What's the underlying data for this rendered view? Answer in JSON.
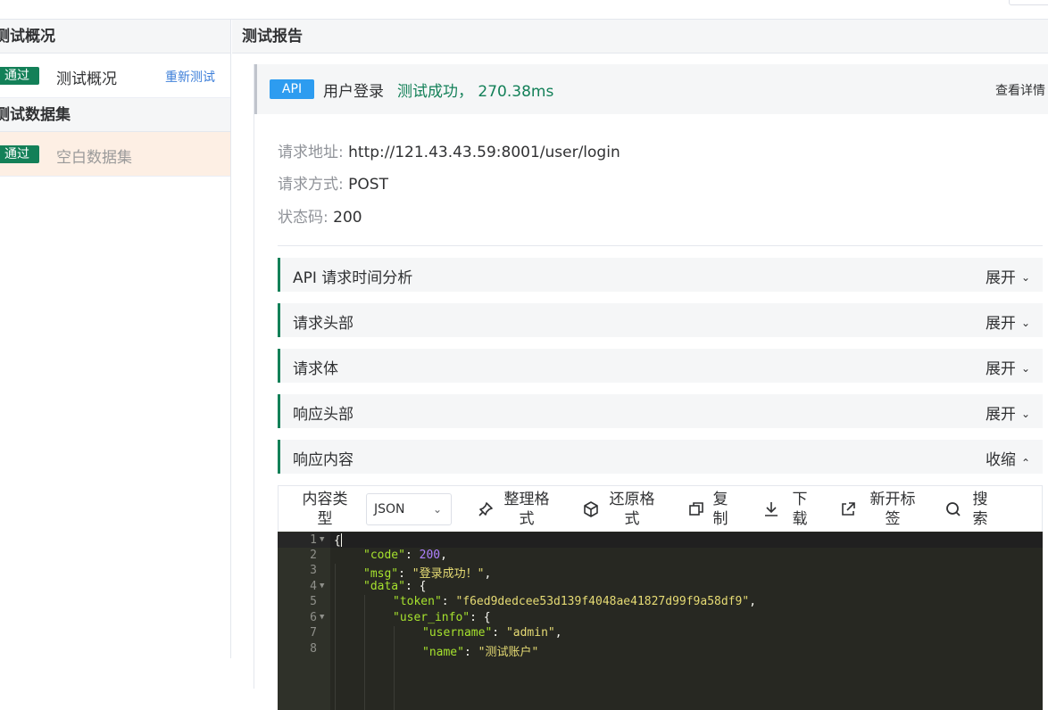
{
  "sidebar": {
    "overview_header": "测试概况",
    "overview_row": {
      "tag": "通过",
      "label": "测试概况",
      "link": "重新测试"
    },
    "dataset_header": "测试数据集",
    "dataset_row": {
      "tag": "通过",
      "label": "空白数据集"
    }
  },
  "main": {
    "header": "测试报告",
    "api": {
      "tag": "API",
      "name": "用户登录",
      "result": "测试成功， 270.38ms",
      "detail_link": "查看详情"
    },
    "info": {
      "url_key": "请求地址:",
      "url_value": "http://121.43.43.59:8001/user/login",
      "method_key": "请求方式:",
      "method_value": "POST",
      "status_key": "状态码:",
      "status_value": "200"
    },
    "sections": [
      {
        "title": "API 请求时间分析",
        "toggle": "展开"
      },
      {
        "title": "请求头部",
        "toggle": "展开"
      },
      {
        "title": "请求体",
        "toggle": "展开"
      },
      {
        "title": "响应头部",
        "toggle": "展开"
      },
      {
        "title": "响应内容",
        "toggle": "收缩"
      }
    ],
    "toolbar": {
      "content_type_label": "内容类型",
      "content_type_value": "JSON",
      "format_button": "整理格式",
      "restore_button": "还原格式",
      "copy_button": "复制",
      "download_button": "下载",
      "new_tab_button": "新开标签",
      "search_button": "搜索"
    },
    "code": {
      "line_numbers": [
        "1",
        "2",
        "3",
        "4",
        "5",
        "6",
        "7",
        "8"
      ],
      "brace_open": "{",
      "code_key": "\"code\"",
      "code_value": "200",
      "msg_key": "\"msg\"",
      "msg_value": "\"登录成功！\"",
      "data_key": "\"data\"",
      "token_key": "\"token\"",
      "token_value": "\"f6ed9dedcee53d139f4048ae41827d99f9a58df9\"",
      "user_info_key": "\"user_info\"",
      "username_key": "\"username\"",
      "username_value": "\"admin\"",
      "name_key": "\"name\"",
      "name_value": "\"测试账户\""
    }
  }
}
